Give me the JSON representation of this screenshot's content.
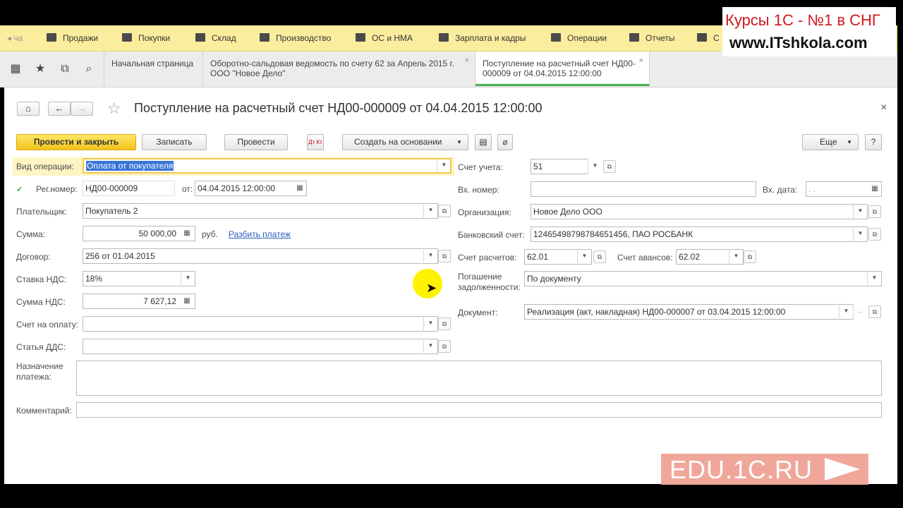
{
  "colors": {
    "menu_bg": "#fbed9e",
    "primary_btn": "#f1c21b",
    "active_tab_underline": "#4caf50",
    "link": "#2b60b8",
    "selection": "#3875d7"
  },
  "menu": {
    "items": [
      {
        "label": "Продажи",
        "icon": "shopping-bag-icon"
      },
      {
        "label": "Покупки",
        "icon": "cart-icon"
      },
      {
        "label": "Склад",
        "icon": "warehouse-icon"
      },
      {
        "label": "Производство",
        "icon": "factory-icon"
      },
      {
        "label": "ОС и НМА",
        "icon": "truck-icon"
      },
      {
        "label": "Зарплата и кадры",
        "icon": "person-icon"
      },
      {
        "label": "Операции",
        "icon": "operations-icon"
      },
      {
        "label": "Отчеты",
        "icon": "bar-chart-icon"
      },
      {
        "label": "С",
        "icon": "book-icon"
      }
    ],
    "left_fragment": "ча"
  },
  "tabs": [
    {
      "label": "Начальная страница"
    },
    {
      "label": "Оборотно-сальдовая ведомость по счету 62 за Апрель 2015 г. ООО \"Новое Дело\""
    },
    {
      "label": "Поступление на расчетный счет НД00-000009 от 04.04.2015 12:00:00",
      "active": true
    }
  ],
  "document": {
    "title": "Поступление на расчетный счет НД00-000009 от 04.04.2015 12:00:00",
    "toolbar": {
      "post_close": "Провести и закрыть",
      "save": "Записать",
      "post": "Провести",
      "create_based": "Создать на основании",
      "more": "Еще",
      "help": "?"
    },
    "left": {
      "operation_type_label": "Вид операции:",
      "operation_type_value": "Оплата от покупателя",
      "reg_number_label": "Рег.номер:",
      "reg_number_value": "НД00-000009",
      "date_from_label": "от:",
      "date_value": "04.04.2015 12:00:00",
      "payer_label": "Плательщик:",
      "payer_value": "Покупатель 2",
      "amount_label": "Сумма:",
      "amount_value": "50 000,00",
      "currency": "руб.",
      "split_payment_link": "Разбить платеж",
      "contract_label": "Договор:",
      "contract_value": "256 от 01.04.2015",
      "vat_rate_label": "Ставка НДС:",
      "vat_rate_value": "18%",
      "vat_amount_label": "Сумма НДС:",
      "vat_amount_value": "7 627,12",
      "invoice_label": "Счет на оплату:",
      "invoice_value": "",
      "dds_label": "Статья ДДС:",
      "dds_value": ""
    },
    "right": {
      "account_label": "Счет учета:",
      "account_value": "51",
      "in_number_label": "Вх. номер:",
      "in_number_value": "",
      "in_date_label": "Вх. дата:",
      "in_date_value": " .  .    ",
      "org_label": "Организация:",
      "org_value": "Новое Дело ООО",
      "bank_account_label": "Банковский счет:",
      "bank_account_value": "12465498798784651456, ПАО РОСБАНК",
      "settlement_account_label": "Счет расчетов:",
      "settlement_account_value": "62.01",
      "advance_account_label": "Счет авансов:",
      "advance_account_value": "62.02",
      "debt_repayment_label_1": "Погашение",
      "debt_repayment_label_2": "задолженности:",
      "debt_repayment_value": "По документу",
      "document_label": "Документ:",
      "document_value": "Реализация (акт, накладная) НД00-000007 от 03.04.2015 12:00:00"
    },
    "purpose_label_1": "Назначение",
    "purpose_label_2": "платежа:",
    "purpose_value": "",
    "comment_label": "Комментарий:",
    "comment_value": ""
  },
  "watermarks": {
    "courses_line1": "Курсы 1С - №1 в СНГ",
    "courses_line2": "www.ITshkola.com",
    "edu": "EDU.1C.RU"
  }
}
